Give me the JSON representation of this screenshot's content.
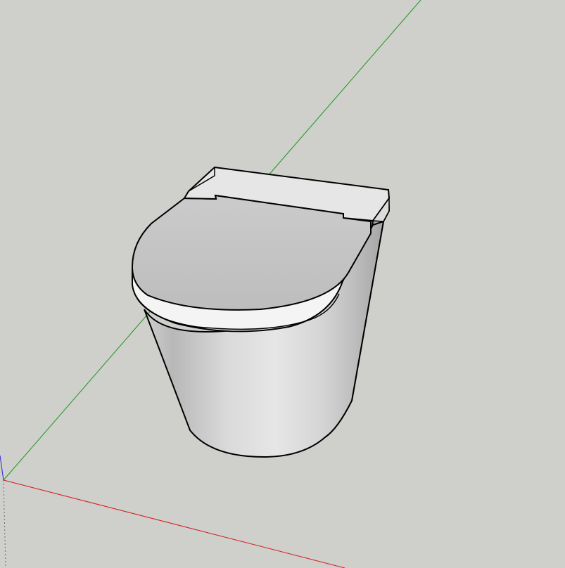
{
  "viewport": {
    "background_color": "#cfcfcb",
    "axes": {
      "x_axis_color": "#d21e1e",
      "y_axis_color": "#1a9a1a",
      "z_axis_color": "#2828d2"
    },
    "model": {
      "name": "toilet",
      "outline_color": "#000000",
      "body_light_color": "#e4e4e4",
      "body_shadow_color": "#a8a8a8",
      "lid_color": "#c6c6c6",
      "seat_rim_color": "#f4f4f4",
      "cistern_top_color": "#e6e6e6"
    }
  }
}
